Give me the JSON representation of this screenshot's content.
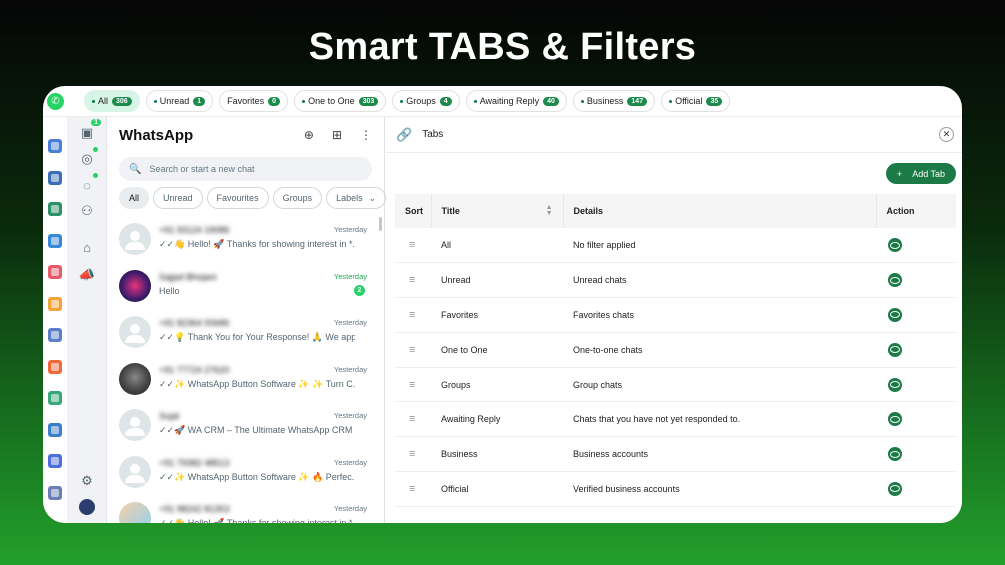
{
  "headline": "Smart TABS & Filters",
  "filter_bar": [
    {
      "label": "All",
      "count": "306",
      "active": true
    },
    {
      "label": "Unread",
      "count": "1"
    },
    {
      "label": "Favorites",
      "count": "0"
    },
    {
      "label": "One to One",
      "count": "303"
    },
    {
      "label": "Groups",
      "count": "4"
    },
    {
      "label": "Awaiting Reply",
      "count": "40"
    },
    {
      "label": "Business",
      "count": "147"
    },
    {
      "label": "Official",
      "count": "35"
    }
  ],
  "chat_list": {
    "title": "WhatsApp",
    "search_placeholder": "Search or start a new chat",
    "chips": [
      "All",
      "Unread",
      "Favourites",
      "Groups",
      "Labels"
    ],
    "nav_badge": "1",
    "rows": [
      {
        "name": "+91 93124 19086",
        "time": "Yesterday",
        "message": "✓✓👋 Hello! 🚀 Thanks for showing interest in *...",
        "avatar": "default"
      },
      {
        "name": "Sajjad Bhojani",
        "time": "Yesterday",
        "message": "Hello",
        "avatar": "img1",
        "unread": "2"
      },
      {
        "name": "+91 82364 00686",
        "time": "Yesterday",
        "message": "✓✓💡 Thank You for Your Response! 🙏   We app...",
        "avatar": "default"
      },
      {
        "name": "+91 77724 27620",
        "time": "Yesterday",
        "message": "✓✓✨ WhatsApp Button Software ✨  ✨ Turn C...",
        "avatar": "img2"
      },
      {
        "name": "Sujal",
        "time": "Yesterday",
        "message": "✓✓🚀 WA CRM – The Ultimate WhatsApp CRM fo...",
        "avatar": "default"
      },
      {
        "name": "+91 79382 48513",
        "time": "Yesterday",
        "message": "✓✓✨ WhatsApp Button Software ✨   🔥 Perfec...",
        "avatar": "default"
      },
      {
        "name": "+91 98242 81353",
        "time": "Yesterday",
        "message": "✓✓👋 Hello! 🚀 Thanks for showing interest in *...",
        "avatar": "img3"
      }
    ]
  },
  "tabs_panel": {
    "title": "Tabs",
    "add_button": "Add Tab",
    "columns": [
      "Sort",
      "Title",
      "Details",
      "Action"
    ],
    "rows": [
      {
        "title": "All",
        "details": "No filter applied"
      },
      {
        "title": "Unread",
        "details": "Unread chats"
      },
      {
        "title": "Favorites",
        "details": "Favorites chats"
      },
      {
        "title": "One to One",
        "details": "One-to-one chats"
      },
      {
        "title": "Groups",
        "details": "Group chats"
      },
      {
        "title": "Awaiting Reply",
        "details": "Chats that you have not yet responded to."
      },
      {
        "title": "Business",
        "details": "Business accounts"
      },
      {
        "title": "Official",
        "details": "Verified business accounts"
      }
    ]
  },
  "colors": {
    "accent": "#1c7a47",
    "wa_green": "#25d366"
  }
}
